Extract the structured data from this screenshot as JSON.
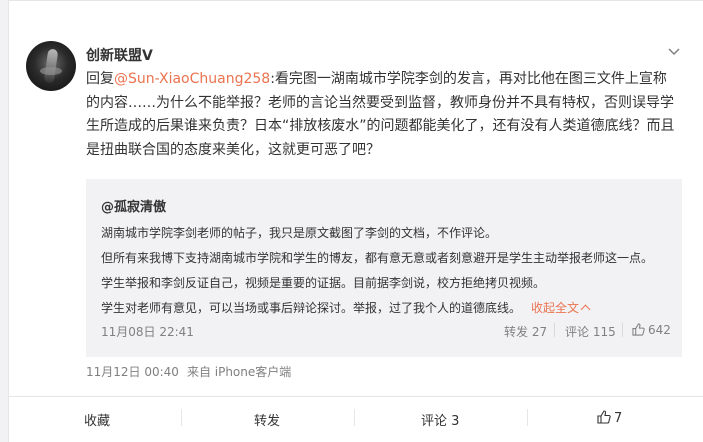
{
  "post": {
    "username": "创新联盟V",
    "reply_prefix": "回复",
    "reply_to": "@Sun-XiaoChuang258",
    "text_line1": ":看完图一湖南城市学院李剑的发言，再对比他在图三文件上宣称",
    "text_line2": "的内容……为什么不能举报？老师的言论当然要受到监督，教师身份并不具有特权，否则误导学",
    "text_line3": "生所造成的后果谁来负责？日本“排放核废水”的问题都能美化了，还有没有人类道德底线？而且",
    "text_line4": "是扭曲联合国的态度来美化，这就更可恶了吧？",
    "time": "11月12日 00:40",
    "source": "来自 iPhone客户端"
  },
  "quote": {
    "username": "@孤寂清傲",
    "line1": "湖南城市学院李剑老师的帖子，我只是原文截图了李剑的文档，不作评论。",
    "line2": "但所有来我博下支持湖南城市学院和学生的博友，都有意无意或者刻意避开是学生主动举报老师这一点。",
    "line3": "学生举报和李剑反证自己，视频是重要的证据。目前据李剑说，校方拒绝拷贝视频。",
    "line4": "学生对老师有意见，可以当场或事后辩论探讨。举报，过了我个人的道德底线。",
    "collapse": "收起全文",
    "time": "11月08日 22:41",
    "repost": "转发 27",
    "comment": "评论 115",
    "likes": "642"
  },
  "actions": {
    "favorite": "收藏",
    "repost": "转发",
    "comment": "评论 3",
    "like": "7"
  },
  "colors": {
    "accent": "#eb7350",
    "link": "#eb7350",
    "muted": "#808080",
    "quote_bg": "#f2f2f5"
  },
  "icons": {
    "more": "chevron-down-icon",
    "like": "thumbs-up-icon",
    "avatar": "avatar-image"
  }
}
